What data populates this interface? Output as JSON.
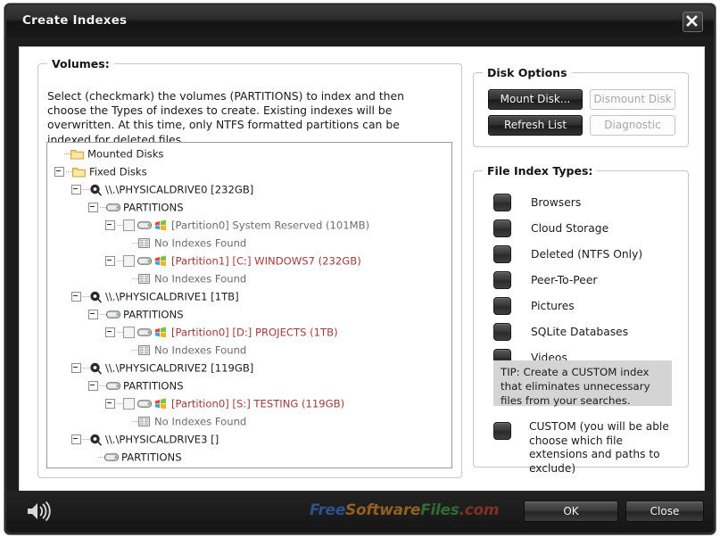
{
  "window": {
    "title": "Create Indexes",
    "close_icon": "close-icon"
  },
  "volumes": {
    "group_title": "Volumes:",
    "intro": "Select (checkmark) the volumes (PARTITIONS) to index and then choose the Types of indexes to create.  Existing indexes will be overwritten.  At this time, only NTFS formatted partitions can be indexed for deleted files.",
    "tree": [
      {
        "label": "Mounted Disks",
        "indent": 0,
        "icon": "folder-icon",
        "expander": "none",
        "checkbox": false,
        "winflag": false,
        "style": "dark"
      },
      {
        "label": "Fixed Disks",
        "indent": 0,
        "icon": "folder-icon",
        "expander": "minus",
        "checkbox": false,
        "winflag": false,
        "style": "dark"
      },
      {
        "label": "\\\\.\\PHYSICALDRIVE0 [232GB]",
        "indent": 1,
        "icon": "harddisk-icon",
        "expander": "minus",
        "checkbox": false,
        "winflag": false,
        "style": "dark"
      },
      {
        "label": "PARTITIONS",
        "indent": 2,
        "icon": "partition-icon",
        "expander": "minus",
        "checkbox": false,
        "winflag": false,
        "style": "dark"
      },
      {
        "label": "[Partition0]  System Reserved (101MB)",
        "indent": 3,
        "icon": "partition-icon",
        "expander": "minus",
        "checkbox": true,
        "winflag": true,
        "style": "gray"
      },
      {
        "label": "No Indexes Found",
        "indent": 4,
        "icon": "index-icon",
        "expander": "none",
        "checkbox": false,
        "winflag": false,
        "style": "gray"
      },
      {
        "label": "[Partition1] [C:] WINDOWS7 (232GB)",
        "indent": 3,
        "icon": "partition-icon",
        "expander": "minus",
        "checkbox": true,
        "winflag": true,
        "style": "red"
      },
      {
        "label": "No Indexes Found",
        "indent": 4,
        "icon": "index-icon",
        "expander": "none",
        "checkbox": false,
        "winflag": false,
        "style": "gray"
      },
      {
        "label": "\\\\.\\PHYSICALDRIVE1 [1TB]",
        "indent": 1,
        "icon": "harddisk-icon",
        "expander": "minus",
        "checkbox": false,
        "winflag": false,
        "style": "dark"
      },
      {
        "label": "PARTITIONS",
        "indent": 2,
        "icon": "partition-icon",
        "expander": "minus",
        "checkbox": false,
        "winflag": false,
        "style": "dark"
      },
      {
        "label": "[Partition0] [D:] PROJECTS (1TB)",
        "indent": 3,
        "icon": "partition-icon",
        "expander": "minus",
        "checkbox": true,
        "winflag": true,
        "style": "red"
      },
      {
        "label": "No Indexes Found",
        "indent": 4,
        "icon": "index-icon",
        "expander": "none",
        "checkbox": false,
        "winflag": false,
        "style": "gray"
      },
      {
        "label": "\\\\.\\PHYSICALDRIVE2 [119GB]",
        "indent": 1,
        "icon": "harddisk-icon",
        "expander": "minus",
        "checkbox": false,
        "winflag": false,
        "style": "dark"
      },
      {
        "label": "PARTITIONS",
        "indent": 2,
        "icon": "partition-icon",
        "expander": "minus",
        "checkbox": false,
        "winflag": false,
        "style": "dark"
      },
      {
        "label": "[Partition0] [S:] TESTING (119GB)",
        "indent": 3,
        "icon": "partition-icon",
        "expander": "minus",
        "checkbox": true,
        "winflag": true,
        "style": "red"
      },
      {
        "label": "No Indexes Found",
        "indent": 4,
        "icon": "index-icon",
        "expander": "none",
        "checkbox": false,
        "winflag": false,
        "style": "gray"
      },
      {
        "label": "\\\\.\\PHYSICALDRIVE3 []",
        "indent": 1,
        "icon": "harddisk-icon",
        "expander": "minus",
        "checkbox": false,
        "winflag": false,
        "style": "dark"
      },
      {
        "label": "PARTITIONS",
        "indent": 2,
        "icon": "partition-icon",
        "expander": "none",
        "checkbox": false,
        "winflag": false,
        "style": "dark"
      }
    ]
  },
  "disk_options": {
    "group_title": "Disk Options",
    "buttons": [
      {
        "label": "Mount Disk...",
        "enabled": true
      },
      {
        "label": "Dismount Disk",
        "enabled": false
      },
      {
        "label": "Refresh List",
        "enabled": true
      },
      {
        "label": "Diagnostic",
        "enabled": false
      }
    ]
  },
  "file_index_types": {
    "group_title": "File Index Types:",
    "items": [
      {
        "label": "Browsers",
        "checked": false
      },
      {
        "label": "Cloud Storage",
        "checked": false
      },
      {
        "label": "Deleted (NTFS Only)",
        "checked": false
      },
      {
        "label": "Peer-To-Peer",
        "checked": false
      },
      {
        "label": "Pictures",
        "checked": false
      },
      {
        "label": "SQLite Databases",
        "checked": false
      },
      {
        "label": "Videos",
        "checked": false
      }
    ],
    "tip": "TIP:  Create a CUSTOM index that eliminates unnecessary files from your searches.",
    "custom": {
      "label": "CUSTOM (you will be able choose which file extensions and paths to exclude)",
      "checked": false
    }
  },
  "footer": {
    "speaker_icon": "speaker-icon",
    "watermark": {
      "part1": "Free",
      "part2": "Software",
      "part3": "Files",
      "part4": ".com"
    },
    "ok_label": "OK",
    "close_label": "Close"
  },
  "colors": {
    "titlebar": "#2b2b2b",
    "panel": "#ffffff",
    "accent_red": "#9d3b3b",
    "watermark_blue": "#3b6fd4",
    "watermark_orange": "#d98a23",
    "watermark_green": "#3f9a44",
    "watermark_red": "#c0392b"
  }
}
